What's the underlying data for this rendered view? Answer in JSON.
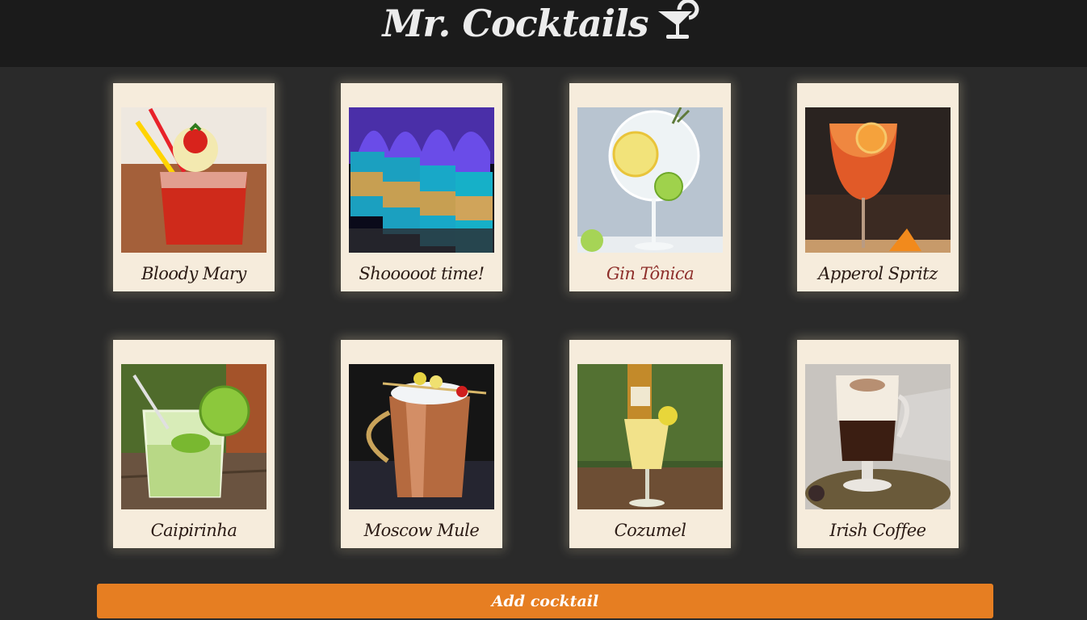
{
  "header": {
    "brand_title": "Mr. Cocktails",
    "brand_icon": "cocktail-glass-icon"
  },
  "cocktails": [
    {
      "name": "Bloody Mary",
      "photo": "bloody-mary-photo"
    },
    {
      "name": "Shooooot time!",
      "photo": "flaming-shots-photo"
    },
    {
      "name": "Gin Tônica",
      "photo": "gin-tonic-photo",
      "highlighted": true
    },
    {
      "name": "Apperol Spritz",
      "photo": "aperol-spritz-photo"
    },
    {
      "name": "Caipirinha",
      "photo": "caipirinha-photo"
    },
    {
      "name": "Moscow Mule",
      "photo": "moscow-mule-photo"
    },
    {
      "name": "Cozumel",
      "photo": "cozumel-photo"
    },
    {
      "name": "Irish Coffee",
      "photo": "irish-coffee-photo"
    }
  ],
  "actions": {
    "add_label": "Add cocktail"
  },
  "colors": {
    "page_bg": "#2a2a2a",
    "header_bg": "#1b1b1b",
    "card_bg": "#f6ecdc",
    "accent": "#e67e22",
    "highlight_text": "#8e2f2b"
  }
}
